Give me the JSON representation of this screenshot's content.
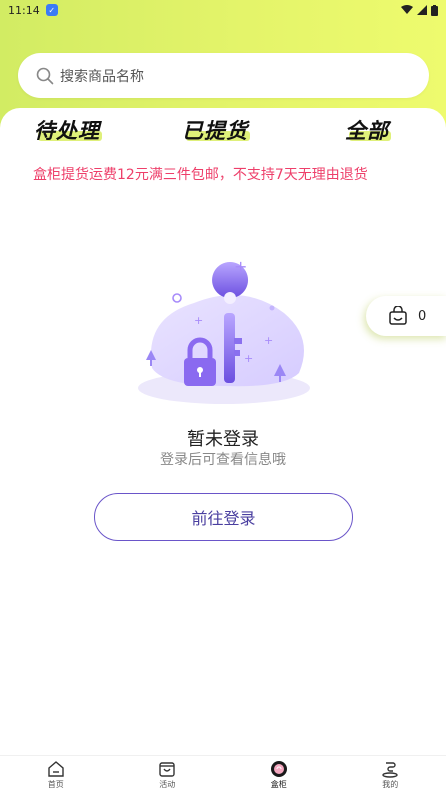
{
  "status_bar": {
    "time": "11:14"
  },
  "search": {
    "placeholder": "搜索商品名称"
  },
  "tabs": [
    {
      "label": "待处理"
    },
    {
      "label": "已提货"
    },
    {
      "label": "全部"
    }
  ],
  "notice": "盒柜提货运费12元满三件包邮，不支持7天无理由退货",
  "cart": {
    "count": "0"
  },
  "empty_state": {
    "title": "暂未登录",
    "subtitle": "登录后可查看信息哦",
    "button": "前往登录"
  },
  "bottom_nav": [
    {
      "label": "首页",
      "icon": "home-icon"
    },
    {
      "label": "活动",
      "icon": "activity-icon"
    },
    {
      "label": "盒柜",
      "icon": "box-cabinet-icon",
      "active": true
    },
    {
      "label": "我的",
      "icon": "profile-icon"
    }
  ],
  "colors": {
    "accent_green": "#dff07a",
    "notice_pink": "#ee3f6a",
    "button_purple": "#6a55c9"
  }
}
